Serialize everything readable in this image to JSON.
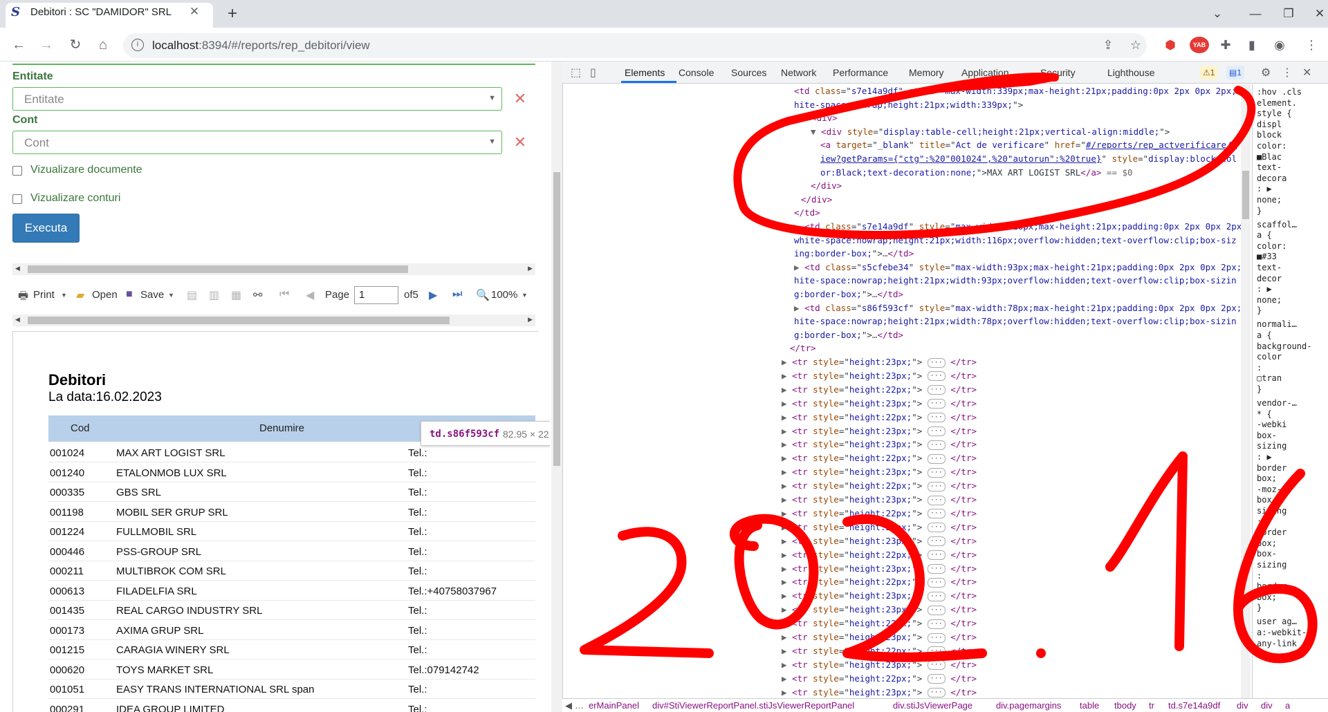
{
  "browser": {
    "tab_title": "Debitori : SC \"DAMIDOR\" SRL",
    "url_host": "localhost",
    "url_path": ":8394/#/reports/rep_debitori/view",
    "ext_badge": "YAB"
  },
  "form": {
    "entitate_label": "Entitate",
    "entitate_placeholder": "Entitate",
    "cont_label": "Cont",
    "cont_placeholder": "Cont",
    "chk_documente": "Vizualizare documente",
    "chk_conturi": "Vizualizare conturi",
    "execute_label": "Executa"
  },
  "viewer_toolbar": {
    "print": "Print",
    "open": "Open",
    "save": "Save",
    "page_label": "Page",
    "page_value": "1",
    "of_pages": "of5",
    "zoom": "100%"
  },
  "report": {
    "title": "Debitori",
    "date": "La data:16.02.2023",
    "col_cod": "Cod",
    "col_denumire": "Denumire",
    "rows": [
      {
        "cod": "001024",
        "denumire": "MAX ART LOGIST SRL",
        "tel": "Tel.:"
      },
      {
        "cod": "001240",
        "denumire": "ETALONMOB LUX SRL",
        "tel": "Tel.:"
      },
      {
        "cod": "000335",
        "denumire": "GBS SRL",
        "tel": "Tel.:"
      },
      {
        "cod": "001198",
        "denumire": "MOBIL SER GRUP SRL",
        "tel": "Tel.:"
      },
      {
        "cod": "001224",
        "denumire": "FULLMOBIL SRL",
        "tel": "Tel.:"
      },
      {
        "cod": "000446",
        "denumire": "PSS-GROUP SRL",
        "tel": "Tel.:"
      },
      {
        "cod": "000211",
        "denumire": "MULTIBROK COM SRL",
        "tel": "Tel.:"
      },
      {
        "cod": "000613",
        "denumire": "FILADELFIA SRL",
        "tel": "Tel.:+40758037967"
      },
      {
        "cod": "001435",
        "denumire": "REAL CARGO INDUSTRY SRL",
        "tel": "Tel.:"
      },
      {
        "cod": "000173",
        "denumire": "AXIMA GRUP SRL",
        "tel": "Tel.:"
      },
      {
        "cod": "001215",
        "denumire": "CARAGIA WINERY SRL",
        "tel": "Tel.:"
      },
      {
        "cod": "000620",
        "denumire": "TOYS MARKET SRL",
        "tel": "Tel.:079142742"
      },
      {
        "cod": "001051",
        "denumire": "EASY TRANS INTERNATIONAL SRL span",
        "tel": "Tel.:"
      },
      {
        "cod": "000291",
        "denumire": "IDEA GROUP LIMITED",
        "tel": "Tel.:"
      }
    ]
  },
  "tooltip": {
    "name": "td.s86f593cf",
    "size": "82.95 × 22"
  },
  "devtools": {
    "tabs": [
      "Elements",
      "Console",
      "Sources",
      "Network",
      "Performance",
      "Memory",
      "Application",
      "Security",
      "Lighthouse"
    ],
    "warn_count": "1",
    "info_count": "1",
    "lines": [
      {
        "indent": 0,
        "parts": [
          [
            "tg",
            "<td "
          ],
          [
            "at",
            "class"
          ],
          [
            "tx",
            "=\""
          ],
          [
            "av",
            "s7e14a9df"
          ],
          [
            "tx",
            "\" "
          ],
          [
            "at",
            "style"
          ],
          [
            "tx",
            "=\""
          ],
          [
            "av",
            "max-width:339px;max-height:21px;padding:0px 2px 0px 2px;w"
          ]
        ]
      },
      {
        "indent": 0,
        "parts": [
          [
            "av",
            "hite-space:nowrap;height:21px;width:339px;"
          ],
          [
            "tx",
            "\">"
          ]
        ]
      },
      {
        "indent": 1,
        "parts": [
          [
            "gr",
            "▼ "
          ],
          [
            "tg",
            "<div>"
          ]
        ]
      },
      {
        "indent": 2,
        "parts": [
          [
            "gr",
            "▼ "
          ],
          [
            "tg",
            "<div "
          ],
          [
            "at",
            "style"
          ],
          [
            "tx",
            "=\""
          ],
          [
            "av",
            "display:table-cell;height:21px;vertical-align:middle;"
          ],
          [
            "tx",
            "\">"
          ]
        ]
      },
      {
        "indent": 3,
        "parts": [
          [
            "tg",
            "<a "
          ],
          [
            "at",
            "target"
          ],
          [
            "tx",
            "=\""
          ],
          [
            "av",
            "_blank"
          ],
          [
            "tx",
            "\" "
          ],
          [
            "at",
            "title"
          ],
          [
            "tx",
            "=\""
          ],
          [
            "av",
            "Act de verificare"
          ],
          [
            "tx",
            "\" "
          ],
          [
            "at",
            "href"
          ],
          [
            "tx",
            "=\""
          ],
          [
            "lk",
            "#/reports/rep_actverificare/v"
          ]
        ]
      },
      {
        "indent": 3,
        "parts": [
          [
            "lk",
            "iew?getParams={\"ctg\":%20\"001024\",%20\"autorun\":%20true}"
          ],
          [
            "tx",
            "\" "
          ],
          [
            "at",
            "style"
          ],
          [
            "tx",
            "=\""
          ],
          [
            "av",
            "display:block;col"
          ]
        ]
      },
      {
        "indent": 3,
        "parts": [
          [
            "av",
            "or:Black;text-decoration:none;"
          ],
          [
            "tx",
            "\">MAX ART LOGIST SRL"
          ],
          [
            "tg",
            "</a>"
          ],
          [
            "gr",
            " == $0"
          ]
        ]
      },
      {
        "indent": 2,
        "parts": [
          [
            "tg",
            "</div>"
          ]
        ]
      },
      {
        "indent": 1,
        "parts": [
          [
            "tg",
            "</div>"
          ]
        ]
      },
      {
        "indent": 0,
        "parts": [
          [
            "tg",
            "</td>"
          ]
        ]
      },
      {
        "indent": 0,
        "parts": [
          [
            "gr",
            "▶ "
          ],
          [
            "tg",
            "<td "
          ],
          [
            "at",
            "class"
          ],
          [
            "tx",
            "=\""
          ],
          [
            "av",
            "s7e14a9df"
          ],
          [
            "tx",
            "\" "
          ],
          [
            "at",
            "style"
          ],
          [
            "tx",
            "=\""
          ],
          [
            "av",
            "max-width:116px;max-height:21px;padding:0px 2px 0px 2px;"
          ]
        ]
      },
      {
        "indent": 0,
        "parts": [
          [
            "av",
            "white-space:nowrap;height:21px;width:116px;overflow:hidden;text-overflow:clip;box-siz"
          ]
        ]
      },
      {
        "indent": 0,
        "parts": [
          [
            "av",
            "ing:border-box;"
          ],
          [
            "tx",
            "\">"
          ],
          [
            "gr",
            "…"
          ],
          [
            "tg",
            "</td>"
          ]
        ]
      },
      {
        "indent": 0,
        "parts": [
          [
            "gr",
            "▶ "
          ],
          [
            "tg",
            "<td "
          ],
          [
            "at",
            "class"
          ],
          [
            "tx",
            "=\""
          ],
          [
            "av",
            "s5cfebe34"
          ],
          [
            "tx",
            "\" "
          ],
          [
            "at",
            "style"
          ],
          [
            "tx",
            "=\""
          ],
          [
            "av",
            "max-width:93px;max-height:21px;padding:0px 2px 0px 2px;w"
          ]
        ]
      },
      {
        "indent": 0,
        "parts": [
          [
            "av",
            "hite-space:nowrap;height:21px;width:93px;overflow:hidden;text-overflow:clip;box-sizin"
          ]
        ]
      },
      {
        "indent": 0,
        "parts": [
          [
            "av",
            "g:border-box;"
          ],
          [
            "tx",
            "\">"
          ],
          [
            "gr",
            "…"
          ],
          [
            "tg",
            "</td>"
          ]
        ]
      },
      {
        "indent": 0,
        "parts": [
          [
            "gr",
            "▶ "
          ],
          [
            "tg",
            "<td "
          ],
          [
            "at",
            "class"
          ],
          [
            "tx",
            "=\""
          ],
          [
            "av",
            "s86f593cf"
          ],
          [
            "tx",
            "\" "
          ],
          [
            "at",
            "style"
          ],
          [
            "tx",
            "=\""
          ],
          [
            "av",
            "max-width:78px;max-height:21px;padding:0px 2px 0px 2px;w"
          ]
        ]
      },
      {
        "indent": 0,
        "parts": [
          [
            "av",
            "hite-space:nowrap;height:21px;width:78px;overflow:hidden;text-overflow:clip;box-sizin"
          ]
        ]
      },
      {
        "indent": 0,
        "parts": [
          [
            "av",
            "g:border-box;"
          ],
          [
            "tx",
            "\">"
          ],
          [
            "gr",
            "…"
          ],
          [
            "tg",
            "</td>"
          ]
        ]
      }
    ],
    "tr_close": "</tr>",
    "tr_heights": [
      "23px",
      "23px",
      "22px",
      "23px",
      "22px",
      "23px",
      "23px",
      "22px",
      "23px",
      "22px",
      "23px",
      "22px",
      "23px",
      "23px",
      "22px",
      "23px",
      "22px",
      "23px",
      "23px",
      "22px",
      "23px",
      "22px",
      "23px",
      "22px",
      "23px",
      "23px"
    ],
    "styles": [
      ":hov .cls",
      "element.",
      "style {",
      "  displ",
      "  block",
      "  color:",
      "  ■Blac",
      "  text-",
      "  decora",
      "  : ▶",
      "  none;",
      "}",
      "scaffol…",
      "a {",
      "  color:",
      "  ■#33",
      "  text-",
      "  decor",
      "  : ▶",
      "  none;",
      "}",
      "normali…",
      "a {",
      "  background-",
      "  color",
      "  :",
      "  ▢tran",
      "}",
      "vendor-…",
      "* {",
      "  -webki",
      "  box-",
      "  sizing",
      "  : ▶",
      "  border",
      "  box;",
      "  -moz-",
      "  box-",
      "  sizing",
      "  :",
      "  border",
      "  box;",
      "  box-",
      "  sizing",
      "  :",
      "  border",
      "  box;",
      "}",
      "user ag…",
      "a:-webkit-",
      "any-link {"
    ],
    "crumbs": [
      "erMainPanel",
      "div#StiViewerReportPanel.stiJsViewerReportPanel",
      "div.stiJsViewerPage",
      "div.pagemargins",
      "table",
      "tbody",
      "tr",
      "td.s7e14a9df",
      "div",
      "div",
      "a"
    ]
  }
}
